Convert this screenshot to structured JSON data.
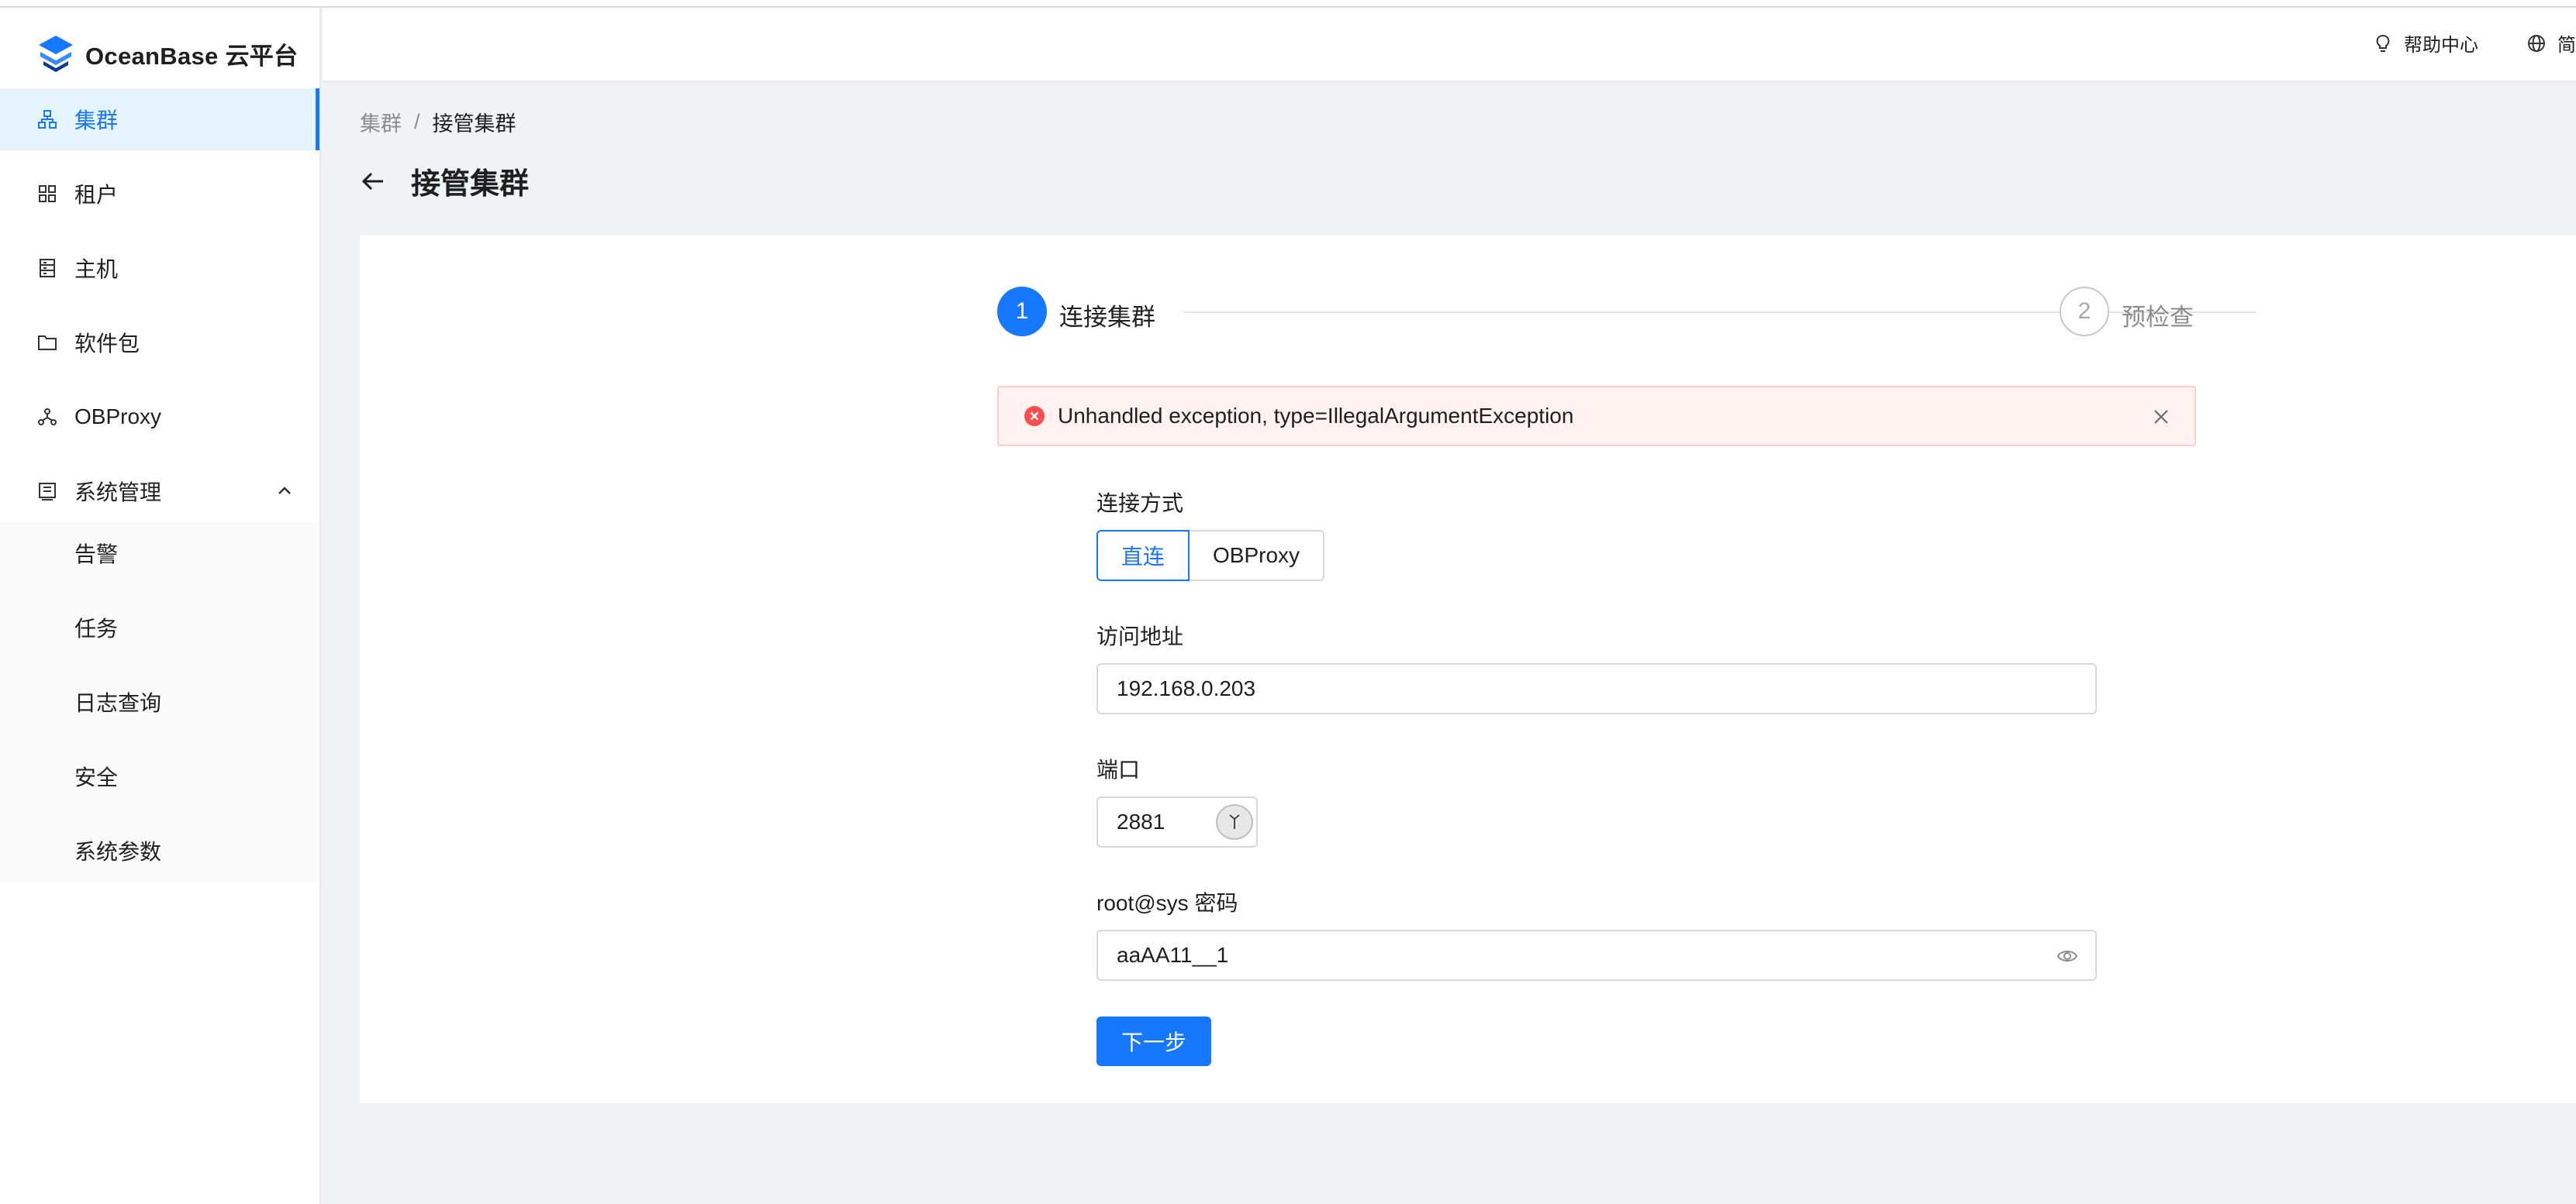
{
  "app": {
    "logo_text": "OceanBase 云平台"
  },
  "sidebar": {
    "items": [
      {
        "label": "集群",
        "icon": "cluster-icon"
      },
      {
        "label": "租户",
        "icon": "grid-icon"
      },
      {
        "label": "主机",
        "icon": "server-icon"
      },
      {
        "label": "软件包",
        "icon": "folder-icon"
      },
      {
        "label": "OBProxy",
        "icon": "proxy-icon"
      },
      {
        "label": "系统管理",
        "icon": "system-icon"
      }
    ],
    "sub_items": [
      "告警",
      "任务",
      "日志查询",
      "安全",
      "系统参数"
    ]
  },
  "header": {
    "help": "帮助中心",
    "language": "简"
  },
  "breadcrumb": {
    "parent": "集群",
    "separator": "/",
    "current": "接管集群"
  },
  "page": {
    "title": "接管集群"
  },
  "steps": [
    {
      "number": "1",
      "title": "连接集群",
      "status": "active"
    },
    {
      "number": "2",
      "title": "预检查",
      "status": "waiting"
    }
  ],
  "alert": {
    "message": "Unhandled exception, type=IllegalArgumentException"
  },
  "form": {
    "connection_label": "连接方式",
    "connection_options": [
      "直连",
      "OBProxy"
    ],
    "address_label": "访问地址",
    "address_value": "192.168.0.203",
    "port_label": "端口",
    "port_value": "2881",
    "password_label": "root@sys 密码",
    "password_value": "aaAA11__1",
    "next_button": "下一步"
  },
  "colors": {
    "primary": "#1677ff",
    "error": "#ff4d4f",
    "alert_bg": "#fff2f0"
  }
}
